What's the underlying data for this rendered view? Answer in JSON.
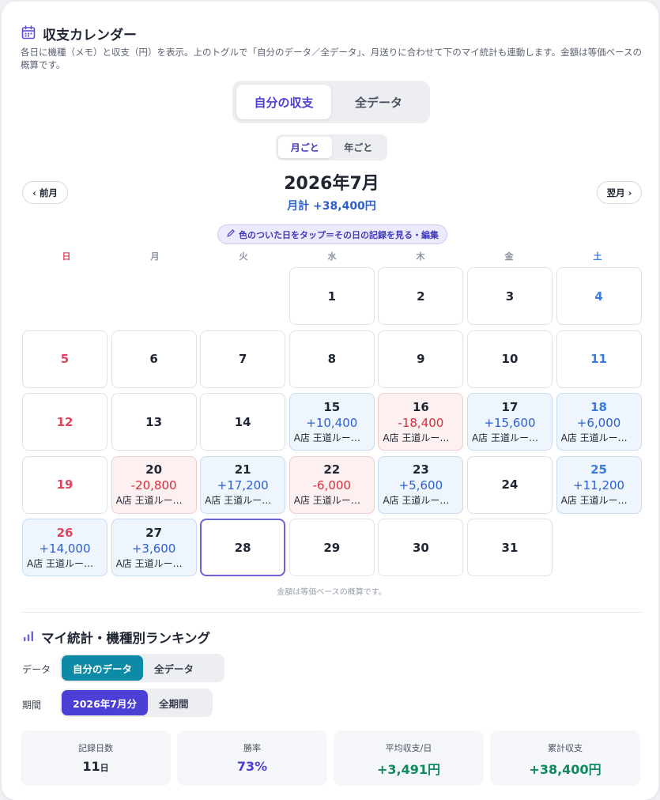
{
  "header": {
    "title": "収支カレンダー",
    "description": "各日に機種（メモ）と収支（円）を表示。上のトグルで「自分のデータ／全データ」、月送りに合わせて下のマイ統計も連動します。金額は等価ベースの概算です。"
  },
  "scope_toggle": {
    "options": [
      "自分の収支",
      "全データ"
    ],
    "selected": "自分の収支"
  },
  "period_toggle": {
    "options": [
      "月ごと",
      "年ごと"
    ],
    "selected": "月ごと"
  },
  "month": {
    "title": "2026年7月",
    "total": "月計 +38,400円",
    "prev_label": "‹ 前月",
    "next_label": "翌月 ›"
  },
  "hint": "色のついた日をタップ＝その日の記録を見る・編集",
  "weekdays": [
    "日",
    "月",
    "火",
    "水",
    "木",
    "金",
    "土"
  ],
  "calendar": [
    {
      "day": "",
      "weekday": "sun"
    },
    {
      "day": "",
      "weekday": "mon"
    },
    {
      "day": "",
      "weekday": "tue"
    },
    {
      "day": "1",
      "weekday": "wed"
    },
    {
      "day": "2",
      "weekday": "thu"
    },
    {
      "day": "3",
      "weekday": "fri"
    },
    {
      "day": "4",
      "weekday": "sat"
    },
    {
      "day": "5",
      "weekday": "sun"
    },
    {
      "day": "6",
      "weekday": "mon"
    },
    {
      "day": "7",
      "weekday": "tue"
    },
    {
      "day": "8",
      "weekday": "wed"
    },
    {
      "day": "9",
      "weekday": "thu"
    },
    {
      "day": "10",
      "weekday": "fri"
    },
    {
      "day": "11",
      "weekday": "sat"
    },
    {
      "day": "12",
      "weekday": "sun"
    },
    {
      "day": "13",
      "weekday": "mon"
    },
    {
      "day": "14",
      "weekday": "tue"
    },
    {
      "day": "15",
      "weekday": "wed",
      "amount": "+10,400",
      "memo": "A店 王道ルーレット",
      "status": "pos"
    },
    {
      "day": "16",
      "weekday": "thu",
      "amount": "-18,400",
      "memo": "A店 王道ルーレット",
      "status": "neg"
    },
    {
      "day": "17",
      "weekday": "fri",
      "amount": "+15,600",
      "memo": "A店 王道ルーレット",
      "status": "pos"
    },
    {
      "day": "18",
      "weekday": "sat",
      "amount": "+6,000",
      "memo": "A店 王道ルーレット",
      "status": "pos"
    },
    {
      "day": "19",
      "weekday": "sun"
    },
    {
      "day": "20",
      "weekday": "mon",
      "amount": "-20,800",
      "memo": "A店 王道ルーレット",
      "status": "neg"
    },
    {
      "day": "21",
      "weekday": "tue",
      "amount": "+17,200",
      "memo": "A店 王道ルーレット",
      "status": "pos"
    },
    {
      "day": "22",
      "weekday": "wed",
      "amount": "-6,000",
      "memo": "A店 王道ルーレット",
      "status": "neg"
    },
    {
      "day": "23",
      "weekday": "thu",
      "amount": "+5,600",
      "memo": "A店 王道ルーレット",
      "status": "pos"
    },
    {
      "day": "24",
      "weekday": "fri"
    },
    {
      "day": "25",
      "weekday": "sat",
      "amount": "+11,200",
      "memo": "A店 王道ルーレット",
      "status": "pos"
    },
    {
      "day": "26",
      "weekday": "sun",
      "amount": "+14,000",
      "memo": "A店 王道ルーレット",
      "status": "pos"
    },
    {
      "day": "27",
      "weekday": "mon",
      "amount": "+3,600",
      "memo": "A店 王道ルーレット",
      "status": "pos"
    },
    {
      "day": "28",
      "weekday": "tue",
      "today": true
    },
    {
      "day": "29",
      "weekday": "wed"
    },
    {
      "day": "30",
      "weekday": "thu"
    },
    {
      "day": "31",
      "weekday": "fri"
    }
  ],
  "calendar_note": "金額は等価ベースの概算です。",
  "stats": {
    "title": "マイ統計・機種別ランキング",
    "data_label": "データ",
    "data_options": [
      "自分のデータ",
      "全データ"
    ],
    "data_selected": "自分のデータ",
    "period_label": "期間",
    "period_options": [
      "2026年7月分",
      "全期間"
    ],
    "period_selected": "2026年7月分",
    "cards": [
      {
        "label": "記録日数",
        "value": "11",
        "unit": "日",
        "color": "#1f2533"
      },
      {
        "label": "勝率",
        "value": "73%",
        "unit": "",
        "color": "#4c3fd6"
      },
      {
        "label": "平均収支/日",
        "value": "+3,491円",
        "unit": "",
        "color": "#0e8a5f"
      },
      {
        "label": "累計収支",
        "value": "+38,400円",
        "unit": "",
        "color": "#0e8a5f"
      }
    ]
  },
  "colors": {
    "accent": "#4c3fd6",
    "teal": "#0d8aa5",
    "positive": "#2d5fd0",
    "negative": "#d62f3a",
    "sunday": "#e0435c",
    "saturday": "#3b7be0"
  }
}
